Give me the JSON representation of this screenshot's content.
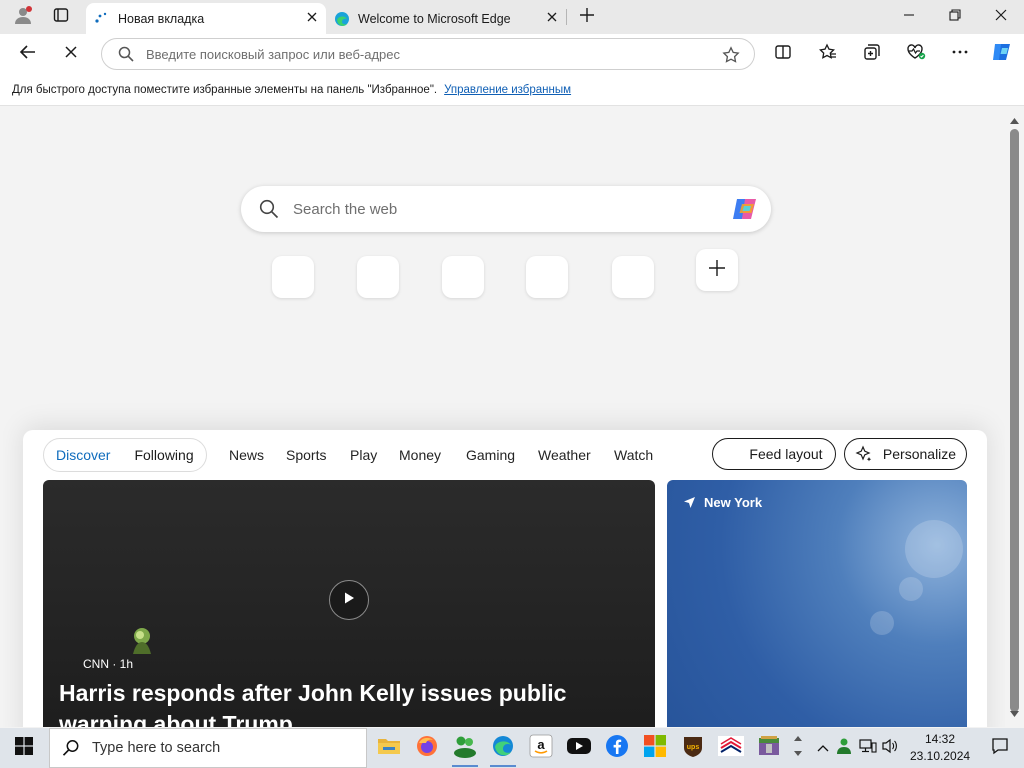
{
  "tabs": [
    {
      "title": "Новая вкладка",
      "active": true,
      "loading": true
    },
    {
      "title": "Welcome to Microsoft Edge",
      "active": false
    }
  ],
  "address_bar": {
    "placeholder": "Введите поисковый запрос или веб-адрес",
    "value": ""
  },
  "favorites_hint": {
    "text": "Для быстрого доступа поместите избранные элементы на панель \"Избранное\".",
    "link": "Управление избранным"
  },
  "newtab": {
    "search_placeholder": "Search the web",
    "quick_links_count": 5,
    "feed": {
      "pill": [
        "Discover",
        "Following"
      ],
      "tabs": [
        "News",
        "Sports",
        "Play",
        "Money",
        "Gaming",
        "Weather",
        "Watch"
      ],
      "feed_layout_label": "Feed layout",
      "personalize_label": "Personalize",
      "hero": {
        "source": "CNN · 1h",
        "headline": "Harris responds after John Kelly issues public warning about Trump"
      },
      "weather": {
        "location": "New York"
      }
    }
  },
  "taskbar": {
    "search_placeholder": "Type here to search",
    "apps": [
      "file-explorer",
      "firefox",
      "network-tool",
      "edge",
      "amazon",
      "youtube",
      "facebook",
      "microsoft-store",
      "ups",
      "bank-of-america",
      "archive"
    ],
    "clock": {
      "time": "14:32",
      "date": "23.10.2024"
    }
  },
  "colors": {
    "accent": "#0f6cbd",
    "link": "#0f5fb5",
    "taskbar": "#dfe4ea"
  }
}
